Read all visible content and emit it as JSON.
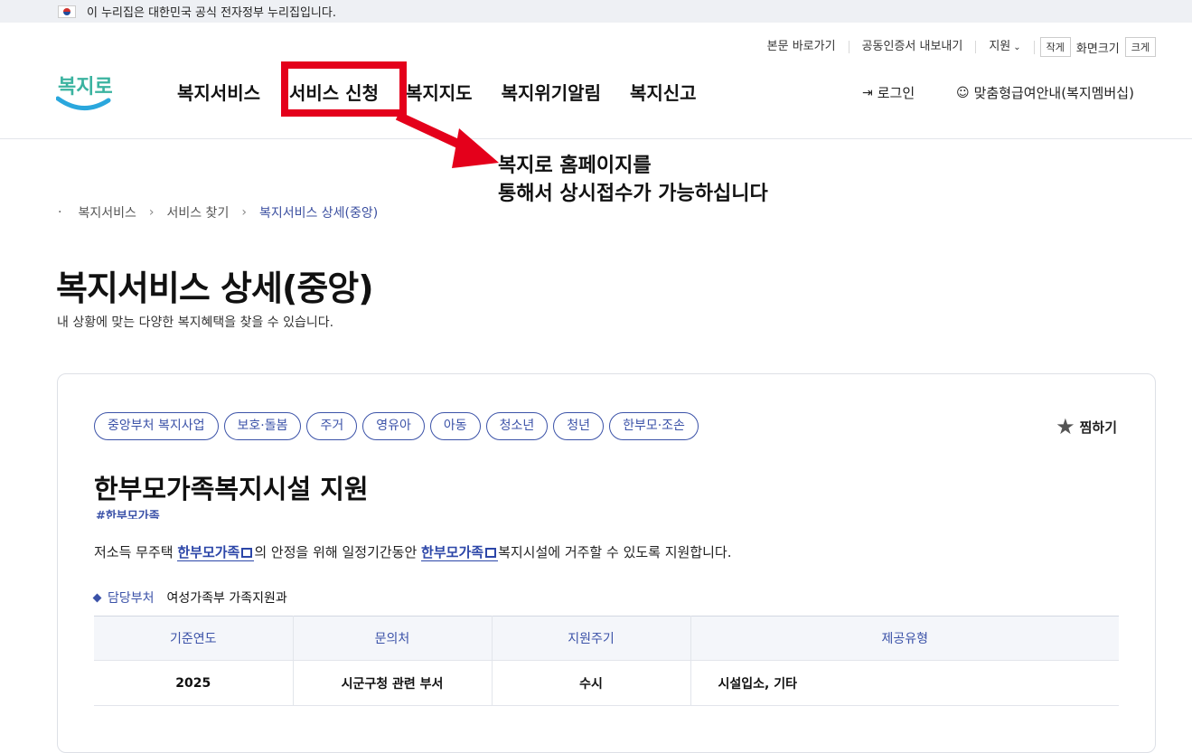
{
  "gov_banner": {
    "text": "이 누리집은 대한민국 공식 전자정부 누리집입니다."
  },
  "util_nav": {
    "skip_link": "본문 바로가기",
    "cert_export": "공동인증서 내보내기",
    "support": "지원",
    "small": "작게",
    "zoom_label": "화면크기",
    "large": "크게"
  },
  "logo": {
    "text": "복지로"
  },
  "gnb": [
    "복지서비스",
    "서비스 신청",
    "복지지도",
    "복지위기알림",
    "복지신고"
  ],
  "account": {
    "login": "로그인",
    "member": "맞춤형급여안내(복지멤버십)"
  },
  "annotation": {
    "line1": "복지로 홈페이지를",
    "line2": "통해서 상시접수가 가능하십니다"
  },
  "breadcrumb": [
    "복지서비스",
    "서비스 찾기",
    "복지서비스 상세(중앙)"
  ],
  "page": {
    "title": "복지서비스 상세(중앙)",
    "subtitle": "내 상황에 맞는 다양한 복지혜택을 찾을 수 있습니다."
  },
  "card": {
    "tags": [
      "중앙부처 복지사업",
      "보호·돌봄",
      "주거",
      "영유아",
      "아동",
      "청소년",
      "청년",
      "한부모·조손"
    ],
    "favorite": "찜하기",
    "title": "한부모가족복지시설 지원",
    "hashtag": "#한부모가족",
    "desc": {
      "part1": "저소득 무주택 ",
      "kw1": "한부모가족",
      "part2": "의 안정을 위해 일정기간동안 ",
      "kw2": "한부모가족",
      "part3": "복지시설에 거주할 수 있도록 지원합니다."
    },
    "dept_label": "담당부처",
    "dept_value": "여성가족부 가족지원과",
    "table": {
      "headers": [
        "기준연도",
        "문의처",
        "지원주기",
        "제공유형"
      ],
      "row": [
        "2025",
        "시군구청 관련 부서",
        "수시",
        "시설입소, 기타"
      ]
    }
  },
  "colors": {
    "highlight_red": "#e4001b",
    "brand_blue": "#3b52a8"
  }
}
